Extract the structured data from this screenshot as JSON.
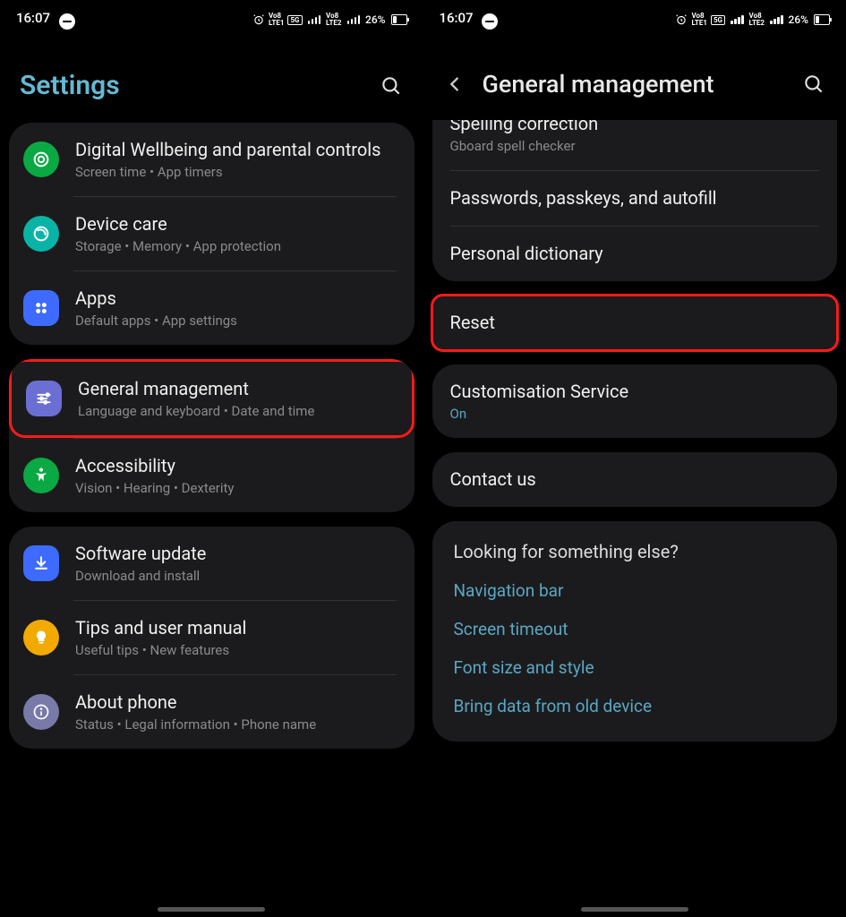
{
  "status": {
    "time": "16:07",
    "battery": "26%"
  },
  "left": {
    "title": "Settings",
    "groups": [
      {
        "items": [
          {
            "icon": "wellbeing",
            "color": "#0aa943",
            "title": "Digital Wellbeing and parental controls",
            "sub": "Screen time  •  App timers"
          },
          {
            "icon": "devicecare",
            "color": "#09b3a6",
            "title": "Device care",
            "sub": "Storage  •  Memory  •  App protection"
          },
          {
            "icon": "apps",
            "color": "#3d6bff",
            "title": "Apps",
            "sub": "Default apps  •  App settings"
          }
        ]
      },
      {
        "items": [
          {
            "icon": "general",
            "color": "#6b6fd3",
            "title": "General management",
            "sub": "Language and keyboard  •  Date and time",
            "highlight": true
          },
          {
            "icon": "accessibility",
            "color": "#0aa943",
            "title": "Accessibility",
            "sub": "Vision  •  Hearing  •  Dexterity"
          }
        ]
      },
      {
        "items": [
          {
            "icon": "update",
            "color": "#3d6bff",
            "title": "Software update",
            "sub": "Download and install"
          },
          {
            "icon": "tips",
            "color": "#f2a900",
            "title": "Tips and user manual",
            "sub": "Useful tips  •  New features"
          },
          {
            "icon": "about",
            "color": "#7a7aa8",
            "title": "About phone",
            "sub": "Status  •  Legal information  •  Phone name"
          }
        ]
      }
    ]
  },
  "right": {
    "title": "General management",
    "topGroup": [
      {
        "title": "Spelling correction",
        "sub": "Gboard spell checker"
      },
      {
        "title": "Passwords, passkeys, and autofill"
      },
      {
        "title": "Personal dictionary"
      }
    ],
    "reset": {
      "title": "Reset"
    },
    "cust": {
      "title": "Customisation Service",
      "sub": "On"
    },
    "contact": {
      "title": "Contact us"
    },
    "looking": {
      "heading": "Looking for something else?",
      "links": [
        "Navigation bar",
        "Screen timeout",
        "Font size and style",
        "Bring data from old device"
      ]
    }
  }
}
